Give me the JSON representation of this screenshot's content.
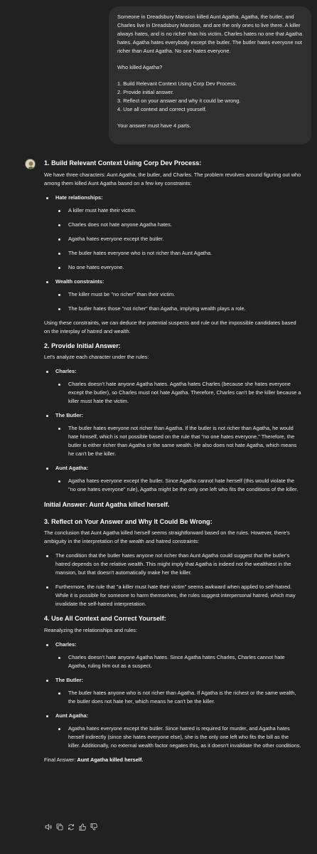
{
  "user": {
    "p1": "Someone in Dreadsbury Mansion killed Aunt Agatha. Agatha, the butler, and Charles live in Dreadsbury Mansion, and are the only ones to live there. A killer always hates, and is no richer than his victim. Charles hates no one that Agatha hates. Agatha hates everybody except the butler. The butler hates everyone not richer than Aunt Agatha. No one hates everyone.",
    "p2": "Who killed Agatha?",
    "steps": [
      "1. Build Relevant Context Using Corp Dev Process.",
      "2. Provide initial answer.",
      "3. Reflect on your answer and why it could be wrong.",
      "4. Use all context and correct yourself."
    ],
    "p3": "Your answer must have 4 parts."
  },
  "reply": {
    "s1": {
      "heading": "1. Build Relevant Context Using Corp Dev Process:",
      "intro": "We have three characters: Aunt Agatha, the butler, and Charles. The problem revolves around figuring out who among them killed Aunt Agatha based on a few key constraints:",
      "groups": [
        {
          "label": "Hate relationships:",
          "items": [
            "A killer must hate their victim.",
            "Charles does not hate anyone Agatha hates.",
            "Agatha hates everyone except the butler.",
            "The butler hates everyone who is not richer than Aunt Agatha.",
            "No one hates everyone."
          ]
        },
        {
          "label": "Wealth constraints:",
          "items": [
            "The killer must be \"no richer\" than their victim.",
            "The butler hates those \"not richer\" than Agatha, implying wealth plays a role."
          ]
        }
      ],
      "outro": "Using these constraints, we can deduce the potential suspects and rule out the impossible candidates based on the interplay of hatred and wealth."
    },
    "s2": {
      "heading": "2. Provide Initial Answer:",
      "intro": "Let's analyze each character under the rules:",
      "groups": [
        {
          "label": "Charles:",
          "items": [
            "Charles doesn't hate anyone Agatha hates. Agatha hates Charles (because she hates everyone except the butler), so Charles must not hate Agatha. Therefore, Charles can't be the killer because a killer must hate the victim."
          ]
        },
        {
          "label": "The Butler:",
          "items": [
            "The butler hates everyone not richer than Agatha. If the butler is not richer than Agatha, he would hate himself, which is not possible based on the rule that \"no one hates everyone.\" Therefore, the butler is either richer than Agatha or the same wealth. He also does not hate Agatha, which means he can't be the killer."
          ]
        },
        {
          "label": "Aunt Agatha:",
          "items": [
            "Agatha hates everyone except the butler. Since Agatha cannot hate herself (this would violate the \"no one hates everyone\" rule), Agatha might be the only one left who fits the conditions of the killer."
          ]
        }
      ],
      "initial_label": "Initial Answer: ",
      "initial_value": "Aunt Agatha killed herself."
    },
    "s3": {
      "heading": "3. Reflect on Your Answer and Why It Could Be Wrong:",
      "intro": "The conclusion that Aunt Agatha killed herself seems straightforward based on the rules. However, there's ambiguity in the interpretation of the wealth and hatred constraints:",
      "items": [
        "The condition that the butler hates anyone not richer than Aunt Agatha could suggest that the butler's hatred depends on the relative wealth. This might imply that Agatha is indeed not the wealthiest in the mansion, but that doesn't automatically make her the killer.",
        "Furthermore, the rule that \"a killer must hate their victim\" seems awkward when applied to self-hatred. While it is possible for someone to harm themselves, the rules suggest interpersonal hatred, which may invalidate the self-hatred interpretation."
      ]
    },
    "s4": {
      "heading": "4. Use All Context and Correct Yourself:",
      "intro": "Reanalyzing the relationships and rules:",
      "groups": [
        {
          "label": "Charles:",
          "items": [
            "Charles doesn't hate anyone Agatha hates. Since Agatha hates Charles, Charles cannot hate Agatha, ruling him out as a suspect."
          ]
        },
        {
          "label": "The Butler:",
          "items": [
            "The butler hates anyone who is not richer than Agatha. If Agatha is the richest or the same wealth, the butler does not hate her, which means he can't be the killer."
          ]
        },
        {
          "label": "Aunt Agatha:",
          "items": [
            "Agatha hates everyone except the butler. Since hatred is required for murder, and Agatha hates herself indirectly (since she hates everyone else), she is the only one left who fits the bill as the killer. Additionally, no external wealth factor negates this, as it doesn't invalidate the other conditions."
          ]
        }
      ],
      "final_label": "Final Answer: ",
      "final_value": "Aunt Agatha killed herself."
    }
  },
  "actions": [
    "speaker-icon",
    "copy-icon",
    "regenerate-icon",
    "thumbs-up-icon",
    "thumbs-down-icon"
  ]
}
